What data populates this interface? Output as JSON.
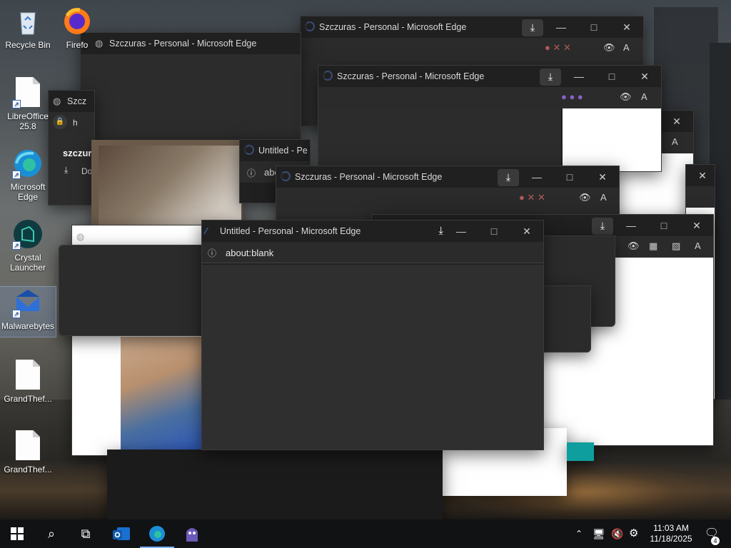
{
  "desktop": {
    "icons": [
      {
        "label": "Recycle Bin",
        "icon": "recycle-bin-icon"
      },
      {
        "label": "Firefo",
        "icon": "firefox-icon"
      },
      {
        "label": "LibreOffice 25.8",
        "icon": "libreoffice-icon"
      },
      {
        "label": "Microsoft Edge",
        "icon": "edge-icon"
      },
      {
        "label": "Crystal Launcher",
        "icon": "crystal-launcher-icon"
      },
      {
        "label": "Malwarebytes",
        "icon": "malwarebytes-icon"
      },
      {
        "label": "GrandThef...",
        "icon": "document-icon"
      },
      {
        "label": "GrandThef...",
        "icon": "document-icon"
      }
    ]
  },
  "windows": {
    "back_title": "Szczuras - Personal - Microsoft Edge",
    "left_title": "Szczuras - Personal - Microsoft Edge",
    "mid_title": "Szczuras - Personal - Microsoft Edge",
    "lower_title": "Szczuras - Personal - Microsoft Edge",
    "partial_untitled": "Untitled - Pe",
    "partial_addr": "abo",
    "partial_left_title": "Szcz",
    "partial_left_addr": "h",
    "partial_left_bold": "szczur",
    "partial_left_dl": "Do",
    "front": {
      "title": "Untitled - Personal - Microsoft Edge",
      "address": "about:blank"
    }
  },
  "taskbar": {
    "time": "11:03 AM",
    "date": "11/18/2025",
    "notification_count": "4"
  },
  "colors": {
    "taskbar": "#101214",
    "window_dark": "#202020",
    "accent": "#0078d4"
  }
}
